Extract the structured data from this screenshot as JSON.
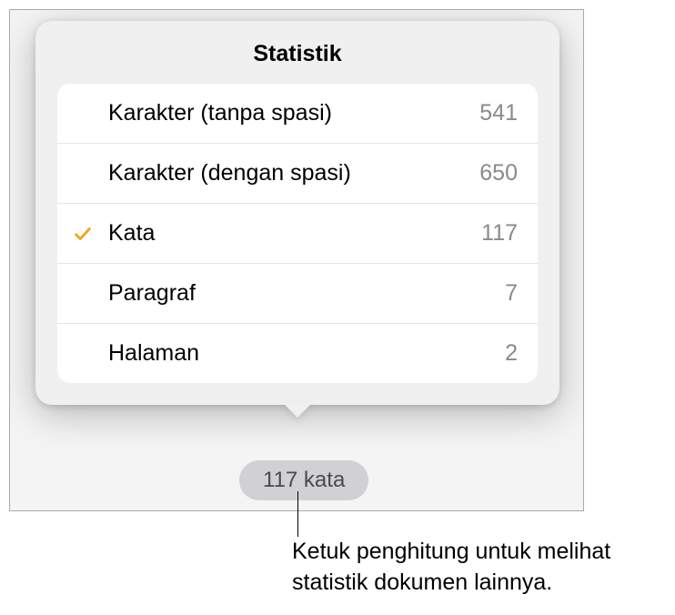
{
  "popover": {
    "title": "Statistik",
    "rows": [
      {
        "label": "Karakter (tanpa spasi)",
        "value": "541",
        "selected": false
      },
      {
        "label": "Karakter (dengan spasi)",
        "value": "650",
        "selected": false
      },
      {
        "label": "Kata",
        "value": "117",
        "selected": true
      },
      {
        "label": "Paragraf",
        "value": "7",
        "selected": false
      },
      {
        "label": "Halaman",
        "value": "2",
        "selected": false
      }
    ]
  },
  "pill": {
    "text": "117 kata"
  },
  "callout": {
    "text": "Ketuk penghitung untuk melihat statistik dokumen lainnya."
  }
}
